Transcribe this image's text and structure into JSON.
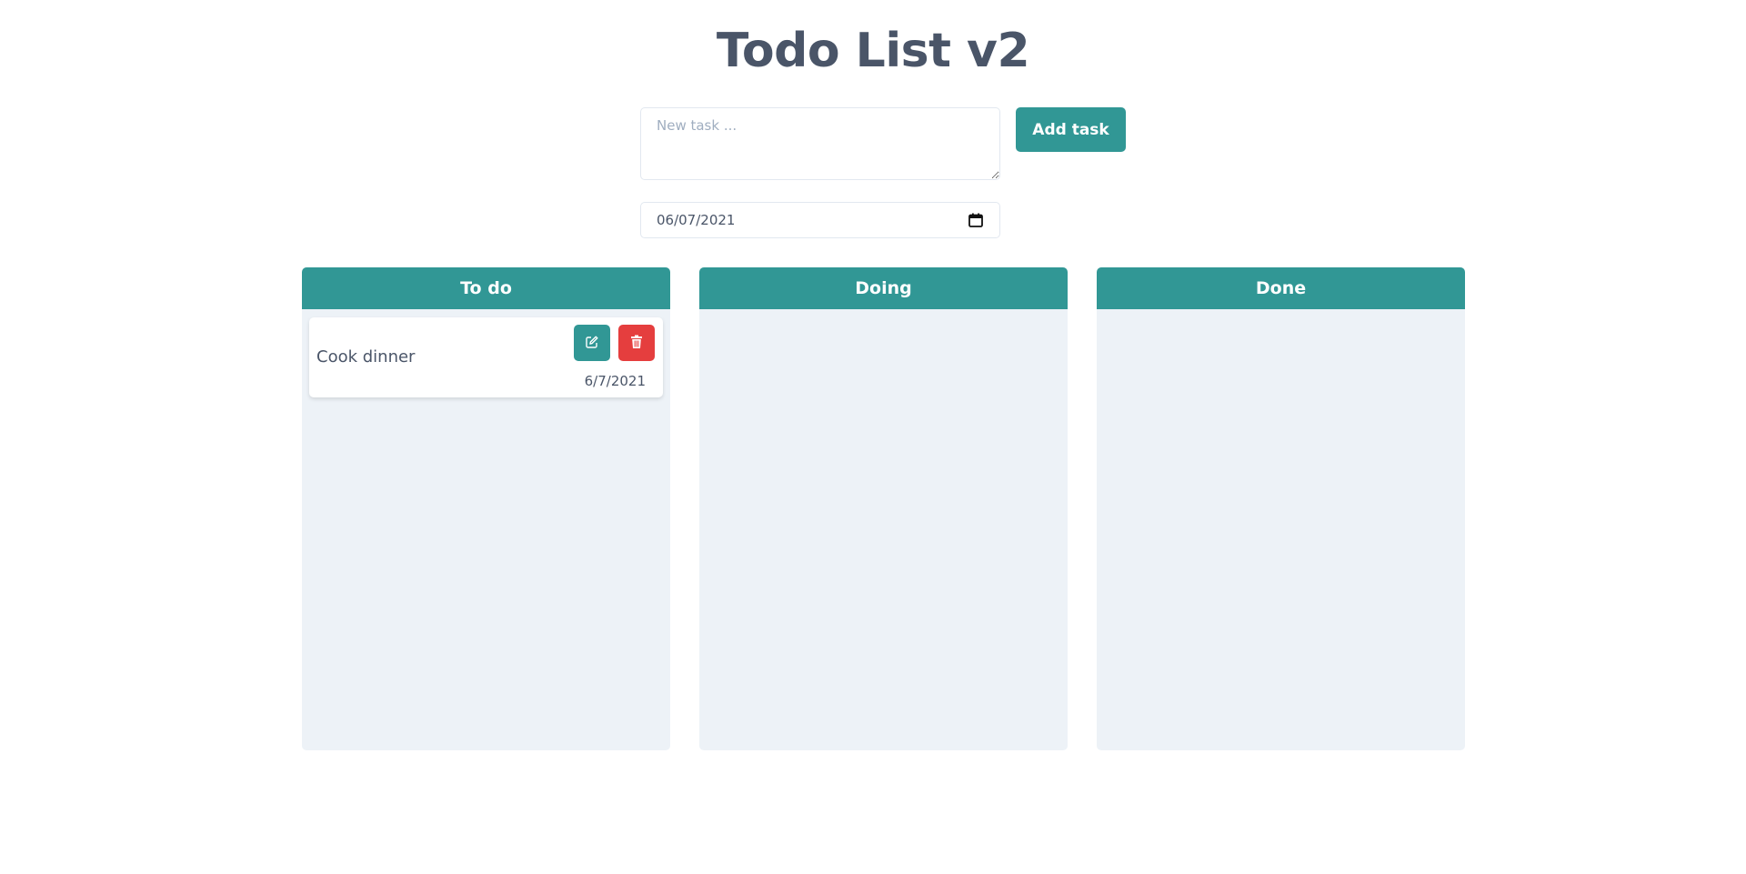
{
  "header": {
    "title": "Todo List v2"
  },
  "form": {
    "task_placeholder": "New task ...",
    "task_value": "",
    "add_label": "Add task",
    "date_value": "06/07/2021"
  },
  "columns": [
    {
      "title": "To do",
      "tasks": [
        {
          "text": "Cook dinner",
          "date": "6/7/2021"
        }
      ]
    },
    {
      "title": "Doing",
      "tasks": []
    },
    {
      "title": "Done",
      "tasks": []
    }
  ],
  "icons": {
    "calendar": "calendar-icon",
    "edit": "edit-icon",
    "delete": "trash-icon"
  },
  "colors": {
    "accent": "#319795",
    "danger": "#e53e3e",
    "column_bg": "#edf2f7",
    "text": "#4a5568"
  }
}
